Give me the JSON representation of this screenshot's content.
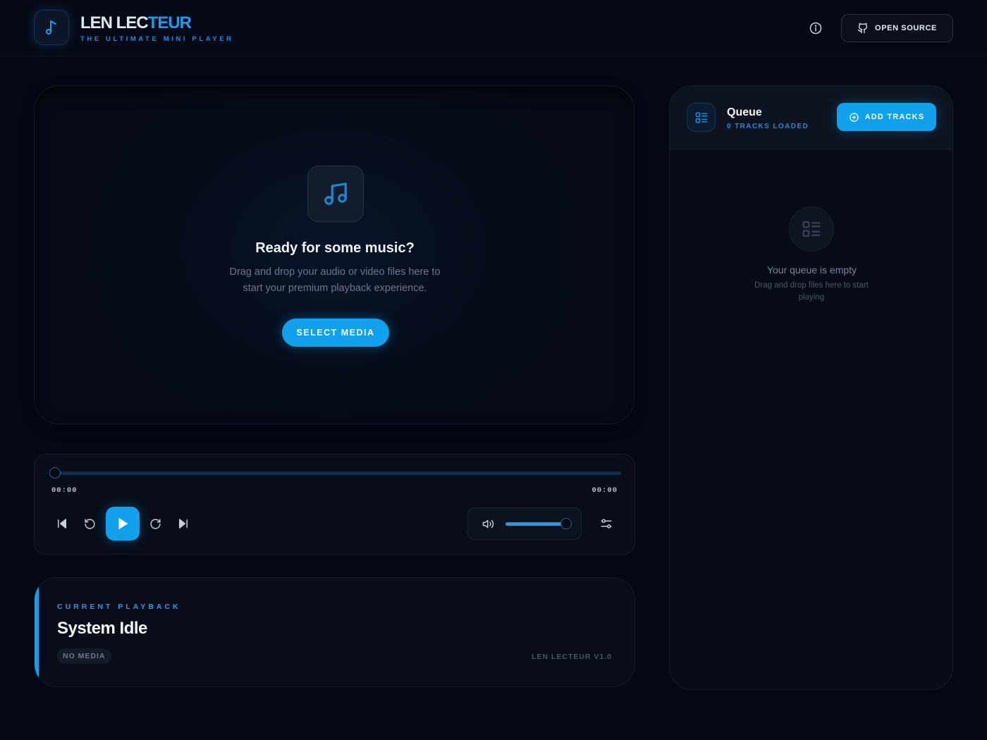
{
  "header": {
    "brand_main": "LEN LEC",
    "brand_accent": "TEUR",
    "tagline": "THE ULTIMATE MINI PLAYER",
    "open_source_label": "OPEN SOURCE"
  },
  "stage": {
    "title": "Ready for some music?",
    "description": "Drag and drop your audio or video files here to start your premium playback experience.",
    "select_label": "SELECT MEDIA"
  },
  "controls": {
    "time_current": "00:00",
    "time_total": "00:00",
    "progress": 0.0,
    "volume": 1.0
  },
  "now_playing": {
    "label": "CURRENT PLAYBACK",
    "title": "System Idle",
    "badge": "NO MEDIA",
    "version": "LEN LECTEUR V1.0"
  },
  "queue": {
    "title": "Queue",
    "count_label": "0 TRACKS LOADED",
    "add_label": "ADD TRACKS",
    "empty_title": "Your queue is empty",
    "empty_desc": "Drag and drop files here to start playing"
  },
  "icons": {
    "logo": "music-note-icon",
    "info": "info-icon",
    "open_source": "github-icon",
    "stage": "music-notes-icon",
    "prev": "skip-back-icon",
    "rewind": "rotate-ccw-icon",
    "play": "play-icon",
    "forward": "rotate-cw-icon",
    "next": "skip-forward-icon",
    "volume": "volume-icon",
    "settings": "sliders-icon",
    "queue": "list-icon",
    "add": "plus-circle-icon"
  },
  "colors": {
    "accent": "#10a0ec",
    "background": "#040814",
    "panel": "#090d19"
  }
}
